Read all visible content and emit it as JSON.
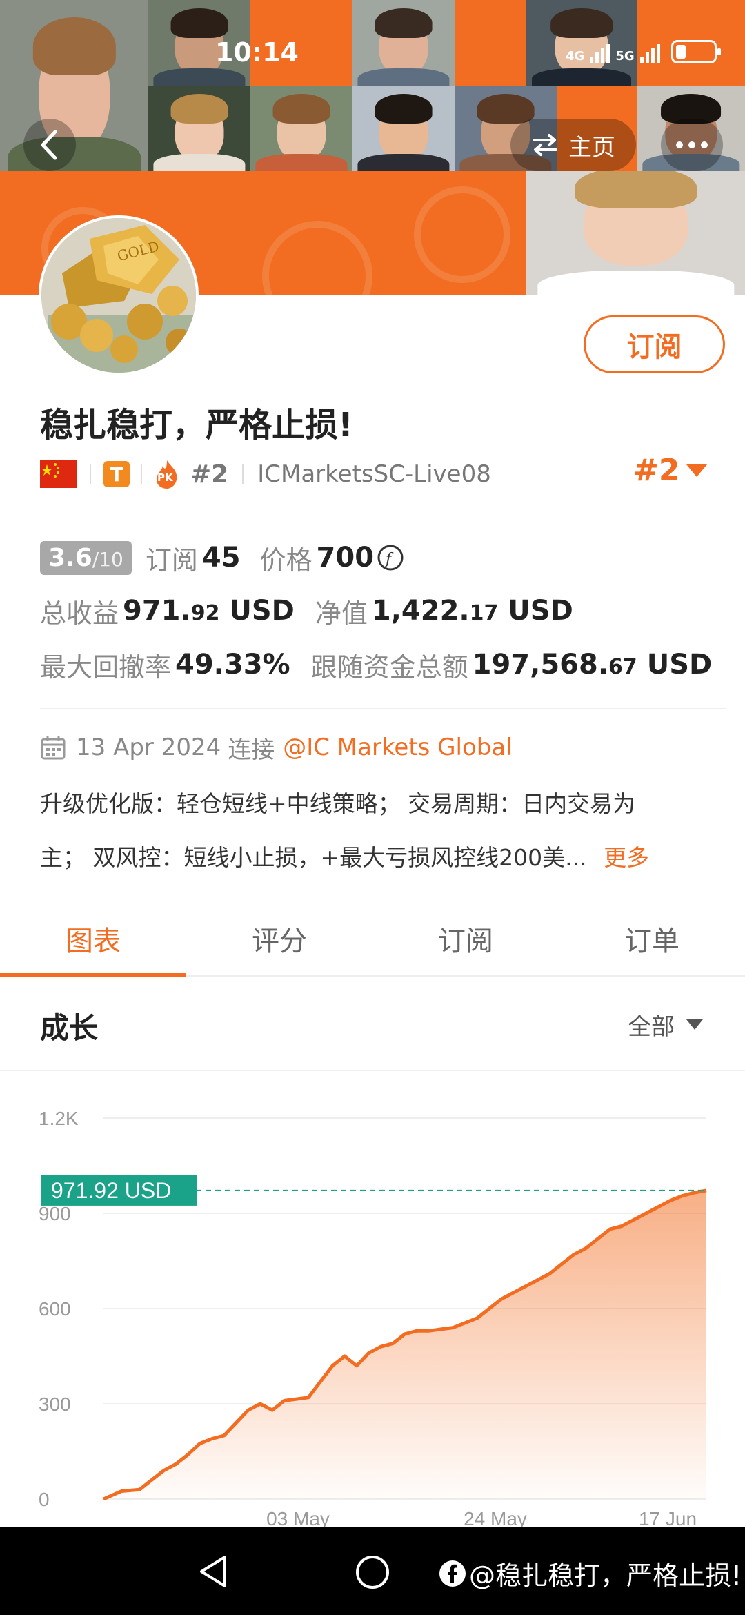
{
  "status_bar": {
    "time": "10:14",
    "network_1": "4G",
    "network_2": "5G"
  },
  "header": {
    "back_icon": "chevron-left-icon",
    "home_label": "主页",
    "more_icon": "more-dots-icon"
  },
  "profile": {
    "title": "稳扎稳打，严格止损!",
    "subscribe_label": "订阅",
    "rank_badge": "#2",
    "account": "ICMarketsSC-Live08",
    "rank_right": "#2",
    "flag": "china-flag-icon",
    "t_badge": "T",
    "pk_badge": "PK"
  },
  "stats": {
    "rating": "3.6",
    "rating_max": "/10",
    "subscribers_label": "订阅",
    "subscribers_value": "45",
    "price_label": "价格",
    "price_value": "700",
    "total_profit_label": "总收益",
    "total_profit_main": "971.",
    "total_profit_dec": "92",
    "total_profit_unit": " USD",
    "equity_label": "净值",
    "equity_main": "1,422.",
    "equity_dec": "17",
    "equity_unit": " USD",
    "drawdown_label": "最大回撤率",
    "drawdown_value": "49.33%",
    "follow_label": "跟随资金总额",
    "follow_main": "197,568.",
    "follow_dec": "67",
    "follow_unit": " USD"
  },
  "info": {
    "date": "13 Apr 2024",
    "connect_label": "连接",
    "broker": "@IC Markets Global",
    "desc_line1": "升级优化版：轻仓短线+中线策略；  交易周期：日内交易为",
    "desc_line2": "主；  双风控：短线小止损，+最大亏损风控线200美...",
    "more_label": "更多"
  },
  "tabs": [
    {
      "label": "图表",
      "active": true
    },
    {
      "label": "评分",
      "active": false
    },
    {
      "label": "订阅",
      "active": false
    },
    {
      "label": "订单",
      "active": false
    }
  ],
  "growth": {
    "title": "成长",
    "filter_label": "全部"
  },
  "chart_data": {
    "type": "area",
    "y_ticks": [
      "1.2K",
      "900",
      "600",
      "300",
      "0"
    ],
    "ylim": [
      0,
      1200
    ],
    "x_ticks": [
      "03 May",
      "24 May",
      "17 Jun"
    ],
    "current_label": "971.92 USD",
    "current_value": 971.92,
    "color": "#f26d21",
    "x": [
      0,
      3,
      6,
      8,
      10,
      12,
      14,
      16,
      18,
      20,
      22,
      24,
      26,
      28,
      30,
      32,
      34,
      36,
      38,
      40,
      42,
      44,
      46,
      48,
      50,
      52,
      54,
      56,
      58,
      60,
      62,
      64,
      66,
      68,
      70,
      72,
      74,
      76,
      78,
      80,
      82,
      84,
      86,
      88,
      90,
      92,
      94,
      96,
      98,
      100
    ],
    "values": [
      0,
      25,
      30,
      60,
      90,
      110,
      140,
      175,
      190,
      200,
      240,
      280,
      300,
      280,
      310,
      315,
      320,
      370,
      420,
      450,
      420,
      460,
      480,
      490,
      520,
      530,
      530,
      535,
      540,
      555,
      570,
      600,
      630,
      650,
      670,
      690,
      710,
      740,
      770,
      790,
      820,
      850,
      860,
      880,
      900,
      920,
      940,
      955,
      965,
      972
    ]
  },
  "nav": {
    "watermark": "@稳扎稳打，严格止损!",
    "back": "nav-back-icon",
    "home": "nav-home-icon"
  }
}
